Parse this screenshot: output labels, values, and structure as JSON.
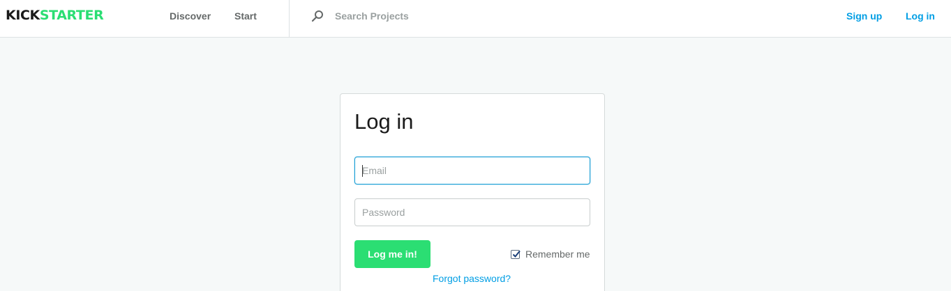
{
  "header": {
    "logo": {
      "part1": "KICK",
      "part2": "STARTER"
    },
    "nav": {
      "discover": "Discover",
      "start": "Start"
    },
    "search": {
      "placeholder": "Search Projects",
      "icon": "search-icon"
    },
    "auth": {
      "signup": "Sign up",
      "login": "Log in"
    }
  },
  "login_form": {
    "title": "Log in",
    "email": {
      "placeholder": "Email",
      "value": ""
    },
    "password": {
      "placeholder": "Password",
      "value": ""
    },
    "submit_label": "Log me in!",
    "remember": {
      "label": "Remember me",
      "checked": true
    },
    "forgot_label": "Forgot password?"
  },
  "colors": {
    "brand_green": "#2bde73",
    "link_blue": "#009ee4",
    "background": "#f6f9f9"
  }
}
